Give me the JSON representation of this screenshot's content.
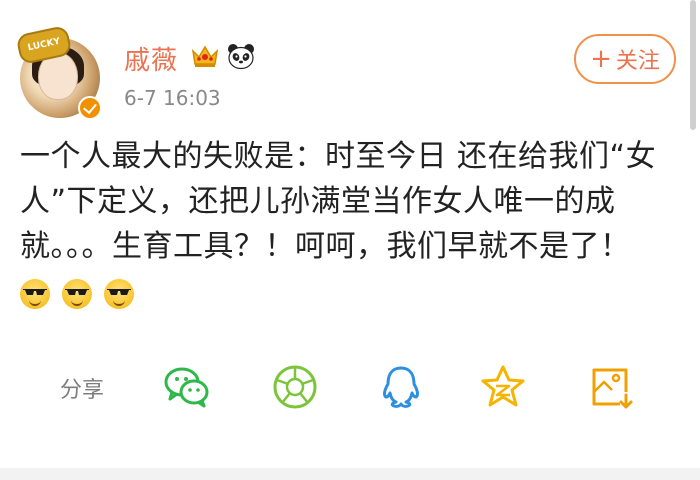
{
  "post": {
    "username": "戚薇",
    "timestamp": "6-7 16:03",
    "follow_label": "关注",
    "follow_plus": "+",
    "avatar_hat_text": "LUCKY",
    "text": "一个人最大的失败是：时至今日 还在给我们“女人”下定义，还把儿孙满堂当作女人唯一的成就。。。生育工具？！呵呵，我们早就不是了！",
    "emoji_count": 3
  },
  "share": {
    "label": "分享",
    "targets": [
      {
        "name": "wechat-icon",
        "color": "#2eb84b"
      },
      {
        "name": "moments-icon",
        "color": "#7cc53a"
      },
      {
        "name": "qq-icon",
        "color": "#2d8fe0"
      },
      {
        "name": "qzone-icon",
        "color": "#f5b400"
      },
      {
        "name": "save-image-icon",
        "color": "#f0a000"
      }
    ]
  },
  "colors": {
    "accent": "#eb7350",
    "text": "#222222",
    "meta": "#888888"
  }
}
